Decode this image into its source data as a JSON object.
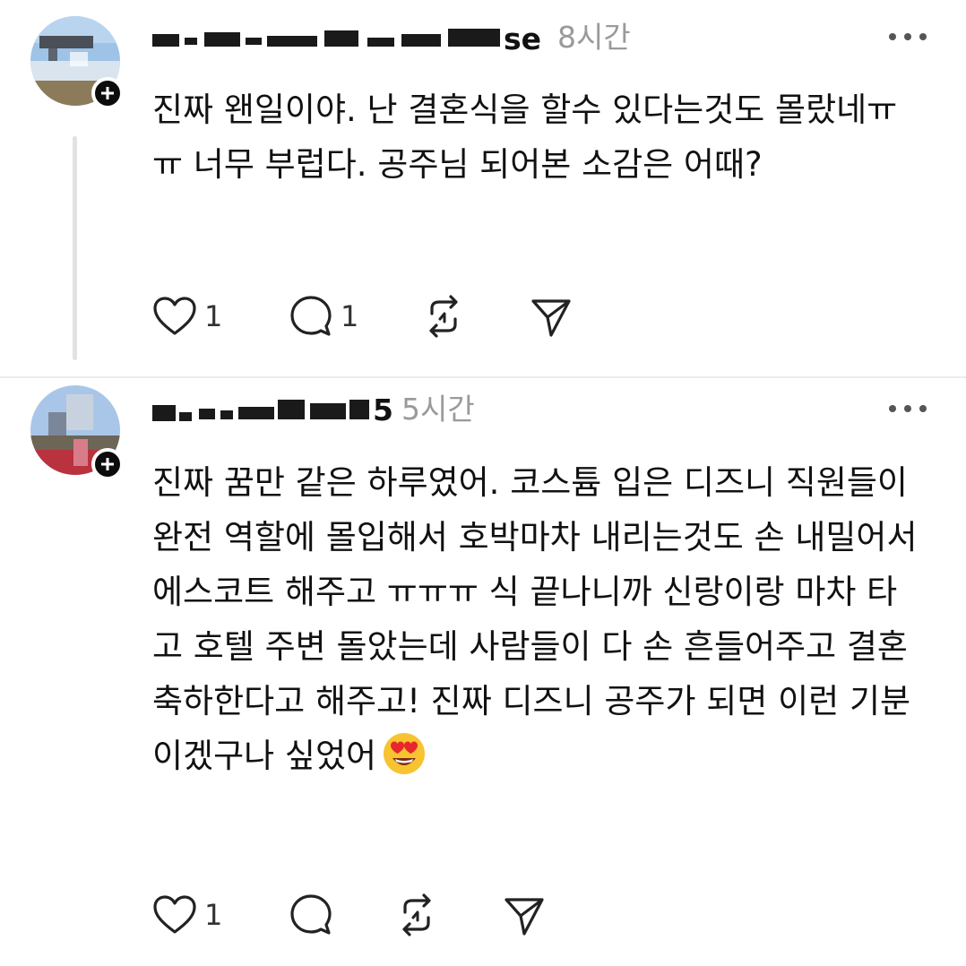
{
  "posts": [
    {
      "username_visible_tail": "se",
      "time": "8시간",
      "text": "진짜 왠일이야. 난 결혼식을 할수 있다는것도 몰랐네ㅠㅠ 너무 부럽다. 공주님 되어본 소감은 어때?",
      "likes": "1",
      "replies": "1",
      "icons": [
        "heart-icon",
        "comment-icon",
        "repost-icon",
        "share-icon"
      ]
    },
    {
      "username_visible_tail": "5",
      "time": "5시간",
      "text": "진짜 꿈만 같은 하루였어. 코스튬 입은 디즈니 직원들이 완전 역할에 몰입해서 호박마차 내리는것도 손 내밀어서 에스코트 해주고 ㅠㅠㅠ 식 끝나니까 신랑이랑 마차 타고 호텔 주변 돌았는데 사람들이 다 손 흔들어주고 결혼 축하한다고 해주고! 진짜 디즈니 공주가 되면 이런 기분이겠구나 싶었어",
      "emoji": "smiling-face-with-heart-eyes-emoji",
      "likes": "1",
      "icons": [
        "heart-icon",
        "comment-icon",
        "repost-icon",
        "share-icon"
      ]
    }
  ],
  "colors": {
    "text": "#111111",
    "muted": "#9a9a9a",
    "thread_line": "#e2e2e2",
    "badge": "#0c0c0c"
  }
}
